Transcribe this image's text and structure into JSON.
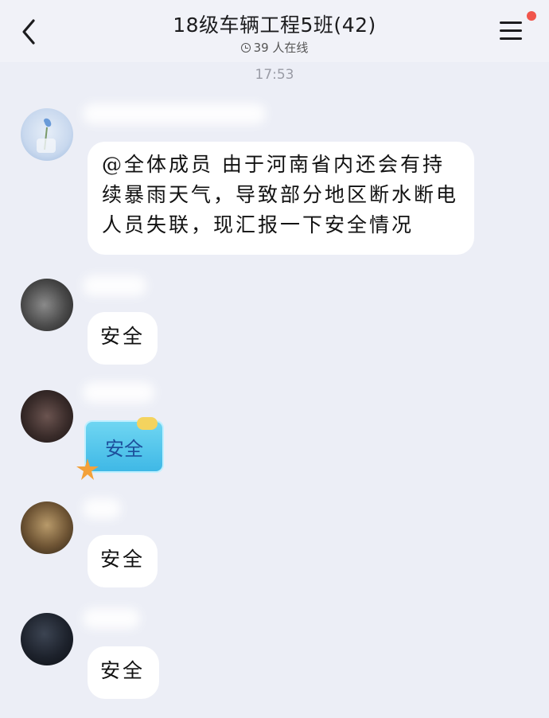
{
  "header": {
    "title": "18级车辆工程5班(42)",
    "online_status": "39 人在线"
  },
  "timestamp": "17:53",
  "messages": [
    {
      "text": "@全体成员 由于河南省内还会有持续暴雨天气，导致部分地区断水断电人员失联，现汇报一下安全情况"
    },
    {
      "text": "安全"
    },
    {
      "text": "安全"
    },
    {
      "text": "安全"
    },
    {
      "text": "安全"
    }
  ],
  "icons": {
    "back": "back-chevron-icon",
    "menu": "hamburger-menu-icon",
    "notification": "notification-dot-icon",
    "online": "clock-icon"
  },
  "colors": {
    "background": "#eceef6",
    "bubble": "#ffffff",
    "notification_dot": "#f1554c"
  }
}
